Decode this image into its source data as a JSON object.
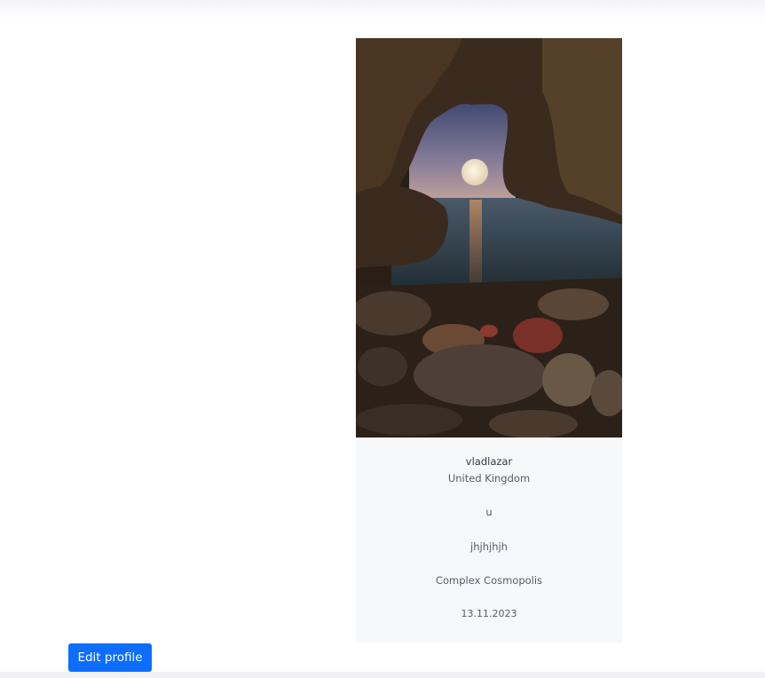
{
  "profile": {
    "photo_alt": "",
    "username": "vladlazar",
    "country": "United Kingdom",
    "field1": "u",
    "field2": "jhjhjhjh",
    "field3": "Complex Cosmopolis",
    "date": "13.11.2023"
  },
  "actions": {
    "edit_label": "Edit profile"
  },
  "colors": {
    "button": "#0d6efd",
    "card_background": "#f7f8fa",
    "text": "#555b66"
  }
}
